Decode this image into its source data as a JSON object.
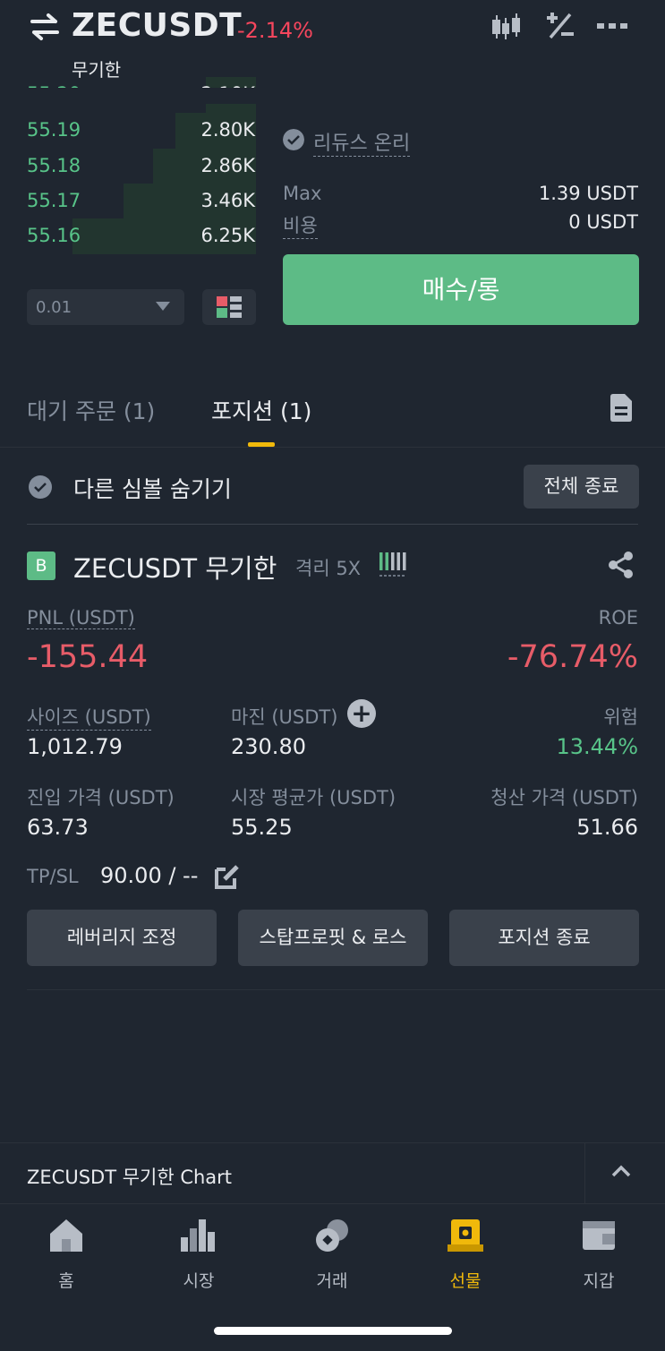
{
  "header": {
    "symbol": "ZECUSDT",
    "change": "-2.14%",
    "contract_type": "무기한"
  },
  "orderbook": {
    "rows": [
      {
        "price": "55.19",
        "qty": "2.80K",
        "depth": 0.35
      },
      {
        "price": "55.18",
        "qty": "2.86K",
        "depth": 0.45
      },
      {
        "price": "55.17",
        "qty": "3.46K",
        "depth": 0.58
      },
      {
        "price": "55.16",
        "qty": "6.25K",
        "depth": 0.8
      }
    ],
    "precision": "0.01"
  },
  "order_form": {
    "reduce_only": "리듀스 온리",
    "max_label": "Max",
    "max_value": "1.39 USDT",
    "fee_label": "비용",
    "fee_value": "0 USDT",
    "buy_button": "매수/롱"
  },
  "tabs": {
    "open_orders": "대기 주문 (1)",
    "positions": "포지션 (1)"
  },
  "positions_panel": {
    "hide_other_symbols": "다른 심볼 숨기기",
    "close_all": "전체 종료"
  },
  "position": {
    "side_badge": "B",
    "symbol": "ZECUSDT 무기한",
    "margin_mode": "격리 5X",
    "pnl_label": "PNL (USDT)",
    "pnl_value": "-155.44",
    "roe_label": "ROE",
    "roe_value": "-76.74%",
    "size_label": "사이즈 (USDT)",
    "size_value": "1,012.79",
    "margin_label": "마진 (USDT)",
    "margin_value": "230.80",
    "risk_label": "위험",
    "risk_value": "13.44%",
    "entry_label": "진입 가격 (USDT)",
    "entry_value": "63.73",
    "mark_label": "시장 평균가 (USDT)",
    "mark_value": "55.25",
    "liq_label": "청산 가격 (USDT)",
    "liq_value": "51.66",
    "tpsl_label": "TP/SL",
    "tpsl_value": "90.00 / --",
    "btn_leverage": "레버리지 조정",
    "btn_tpsl": "스탑프로핏 & 로스",
    "btn_close": "포지션 종료"
  },
  "chart_bar": {
    "label": "ZECUSDT 무기한  Chart"
  },
  "nav": {
    "items": [
      {
        "label": "홈",
        "icon": "home-icon"
      },
      {
        "label": "시장",
        "icon": "markets-icon"
      },
      {
        "label": "거래",
        "icon": "trade-icon"
      },
      {
        "label": "선물",
        "icon": "futures-icon"
      },
      {
        "label": "지갑",
        "icon": "wallet-icon"
      }
    ],
    "active": "선물"
  },
  "colors": {
    "background": "#1f2630",
    "green": "#5dbb86",
    "red": "#e75c68",
    "accent": "#f0b90b"
  }
}
